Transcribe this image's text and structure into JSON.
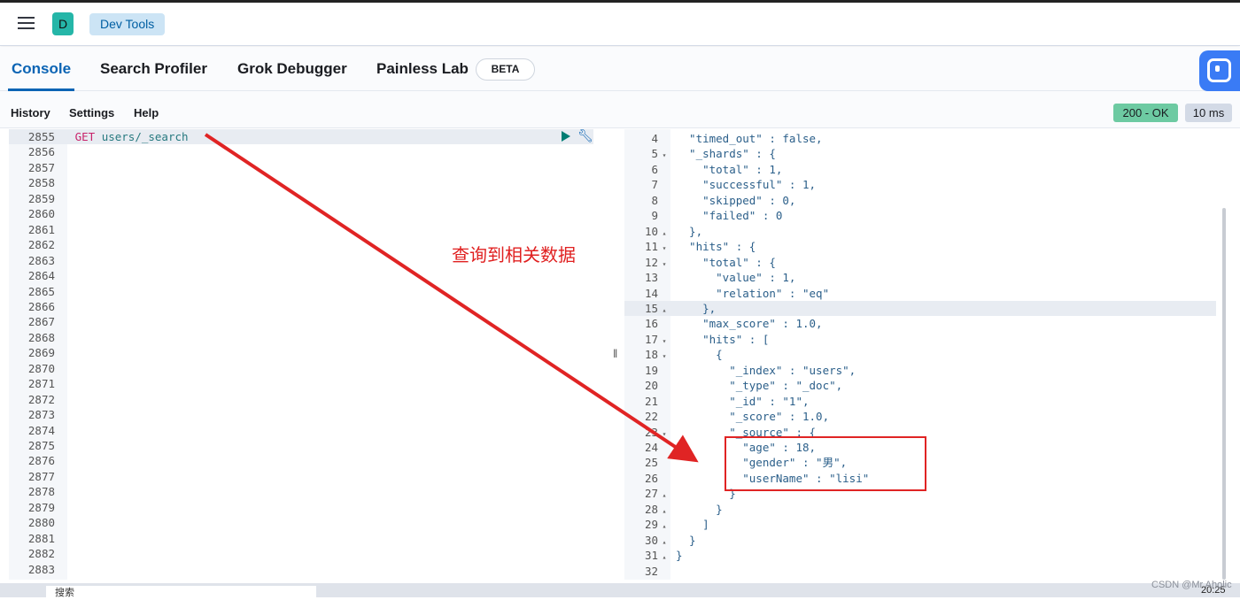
{
  "header": {
    "logo_letter": "D",
    "breadcrumb": "Dev Tools"
  },
  "tabs": [
    {
      "label": "Console",
      "active": true
    },
    {
      "label": "Search Profiler"
    },
    {
      "label": "Grok Debugger"
    },
    {
      "label": "Painless Lab"
    }
  ],
  "beta_badge": "BETA",
  "toolbar": {
    "history": "History",
    "settings": "Settings",
    "help": "Help"
  },
  "status": {
    "code": "200 - OK",
    "time": "10 ms",
    "ok_color": "#6dcaa2"
  },
  "request": {
    "method": "GET",
    "path": "users/_search",
    "line_numbers": [
      2855,
      2856,
      2857,
      2858,
      2859,
      2860,
      2861,
      2862,
      2863,
      2864,
      2865,
      2866,
      2867,
      2868,
      2869,
      2870,
      2871,
      2872,
      2873,
      2874,
      2875,
      2876,
      2877,
      2878,
      2879,
      2880,
      2881,
      2882,
      2883
    ]
  },
  "response": {
    "current_line": 15,
    "lines": [
      {
        "n": 4,
        "t": "  \"timed_out\" : false,"
      },
      {
        "n": 5,
        "f": "▾",
        "t": "  \"_shards\" : {"
      },
      {
        "n": 6,
        "t": "    \"total\" : 1,"
      },
      {
        "n": 7,
        "t": "    \"successful\" : 1,"
      },
      {
        "n": 8,
        "t": "    \"skipped\" : 0,"
      },
      {
        "n": 9,
        "t": "    \"failed\" : 0"
      },
      {
        "n": 10,
        "f": "▴",
        "t": "  },"
      },
      {
        "n": 11,
        "f": "▾",
        "t": "  \"hits\" : {"
      },
      {
        "n": 12,
        "f": "▾",
        "t": "    \"total\" : {"
      },
      {
        "n": 13,
        "t": "      \"value\" : 1,"
      },
      {
        "n": 14,
        "t": "      \"relation\" : \"eq\""
      },
      {
        "n": 15,
        "f": "▴",
        "t": "    },"
      },
      {
        "n": 16,
        "t": "    \"max_score\" : 1.0,"
      },
      {
        "n": 17,
        "f": "▾",
        "t": "    \"hits\" : ["
      },
      {
        "n": 18,
        "f": "▾",
        "t": "      {"
      },
      {
        "n": 19,
        "t": "        \"_index\" : \"users\","
      },
      {
        "n": 20,
        "t": "        \"_type\" : \"_doc\","
      },
      {
        "n": 21,
        "t": "        \"_id\" : \"1\","
      },
      {
        "n": 22,
        "t": "        \"_score\" : 1.0,"
      },
      {
        "n": 23,
        "f": "▾",
        "t": "        \"_source\" : {"
      },
      {
        "n": 24,
        "t": "          \"age\" : 18,"
      },
      {
        "n": 25,
        "t": "          \"gender\" : \"男\","
      },
      {
        "n": 26,
        "t": "          \"userName\" : \"lisi\""
      },
      {
        "n": 27,
        "f": "▴",
        "t": "        }"
      },
      {
        "n": 28,
        "f": "▴",
        "t": "      }"
      },
      {
        "n": 29,
        "f": "▴",
        "t": "    ]"
      },
      {
        "n": 30,
        "f": "▴",
        "t": "  }"
      },
      {
        "n": 31,
        "f": "▴",
        "t": "}"
      },
      {
        "n": 32,
        "t": ""
      }
    ]
  },
  "annotation": {
    "text": "查询到相关数据",
    "color": "#e02020"
  },
  "taskbar": {
    "search_placeholder": "搜索",
    "clock": "20:25"
  },
  "watermark": "CSDN @Mr.Aholic"
}
